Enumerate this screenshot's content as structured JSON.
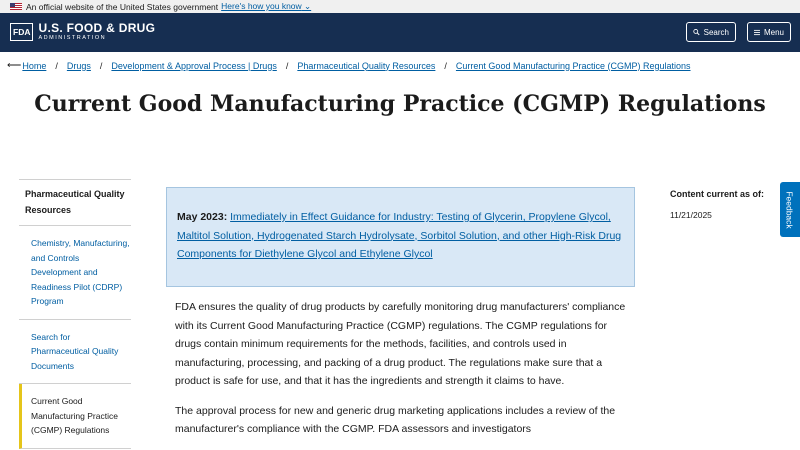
{
  "gov_banner": {
    "text": "An official website of the United States government",
    "link": "Here's how you know"
  },
  "header": {
    "logo_box": "FDA",
    "logo_main": "U.S. FOOD & DRUG",
    "logo_sub": "ADMINISTRATION",
    "search_label": "Search",
    "menu_label": "Menu"
  },
  "breadcrumb": [
    "Home",
    "Drugs",
    "Development & Approval Process | Drugs",
    "Pharmaceutical Quality Resources",
    "Current Good Manufacturing Practice (CGMP) Regulations"
  ],
  "page_title": "Current Good Manufacturing Practice (CGMP) Regulations",
  "sidenav": {
    "heading": "Pharmaceutical Quality Resources",
    "items": [
      "Chemistry, Manufacturing, and Controls Development and Readiness Pilot (CDRP) Program",
      "Search for Pharmaceutical Quality Documents",
      "Current Good Manufacturing Practice (CGMP) Regulations"
    ]
  },
  "alert": {
    "label": "May 2023:",
    "link": "Immediately in Effect Guidance for Industry: Testing of Glycerin, Propylene Glycol, Maltitol Solution, Hydrogenated Starch Hydrolysate, Sorbitol Solution, and other High-Risk Drug Components for Diethylene Glycol and Ethylene Glycol"
  },
  "content": {
    "p1": "FDA ensures the quality of drug products by carefully monitoring drug manufacturers' compliance with its Current Good Manufacturing Practice (CGMP) regulations. The CGMP regulations for drugs contain minimum requirements for the methods, facilities, and controls used in manufacturing, processing, and packing of a drug product. The regulations make sure that a product is safe for use, and that it has the ingredients and strength it claims to have.",
    "p2": "The approval process for new and generic drug marketing applications includes a review of the manufacturer's compliance with the CGMP. FDA assessors and investigators"
  },
  "meta": {
    "label": "Content current as of:",
    "date": "11/21/2025"
  },
  "feedback_label": "Feedback",
  "colors": {
    "header_bg": "#162e51",
    "link": "#005ea2",
    "alert_bg": "#d9e8f6",
    "active_accent": "#e5c51a",
    "feedback_bg": "#0071bc"
  },
  "icons": [
    "us-flag-icon",
    "chevron-down-icon",
    "search-icon",
    "menu-icon",
    "back-arrow-icon"
  ]
}
